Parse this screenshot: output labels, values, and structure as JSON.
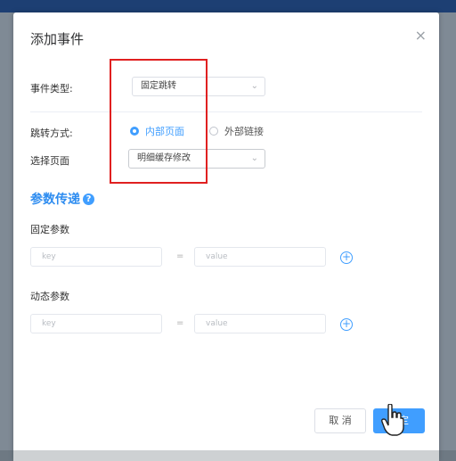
{
  "dialog": {
    "title": "添加事件",
    "close_glyph": "×"
  },
  "form": {
    "event_type": {
      "label": "事件类型:",
      "value": "固定跳转"
    },
    "jump_mode": {
      "label": "跳转方式:",
      "options": [
        {
          "label": "内部页面",
          "checked": true
        },
        {
          "label": "外部链接",
          "checked": false
        }
      ]
    },
    "select_page": {
      "label": "选择页面",
      "value": "明细缓存修改"
    }
  },
  "params": {
    "section_title": "参数传递",
    "help_glyph": "?",
    "fixed": {
      "label": "固定参数",
      "key_placeholder": "key",
      "equals": "=",
      "value_placeholder": "value",
      "add_glyph": "+"
    },
    "dynamic": {
      "label": "动态参数",
      "key_placeholder": "key",
      "equals": "=",
      "value_placeholder": "value",
      "add_glyph": "+"
    }
  },
  "footer": {
    "cancel_label": "取 消",
    "ok_label": "确定"
  },
  "icons": {
    "select_arrow": "chevron-down-icon",
    "help": "question-circle-icon",
    "add": "plus-circle-icon",
    "cursor": "hand-pointer-icon"
  },
  "colors": {
    "accent": "#409eff",
    "annotation": "#e02020",
    "topbar": "#1d3f73"
  }
}
